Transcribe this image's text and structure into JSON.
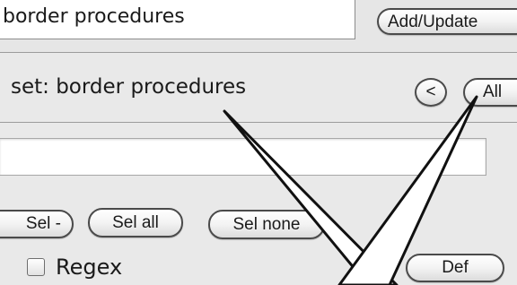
{
  "editor": {
    "name_value": "border procedures",
    "add_update_label": "Add/Update"
  },
  "set_panel": {
    "set_label": "set:  border procedures",
    "prev_label": "<",
    "all_label": "All",
    "filter_value": ""
  },
  "selection": {
    "sel_minus_label": "Sel -",
    "sel_all_label": "Sel all",
    "sel_none_label": "Sel none",
    "def_label": "Def"
  },
  "options": {
    "regex_label": "Regex",
    "regex_checked": false
  },
  "annotation": {
    "stroke_color": "#111111",
    "fill_color": "#ffffff"
  }
}
